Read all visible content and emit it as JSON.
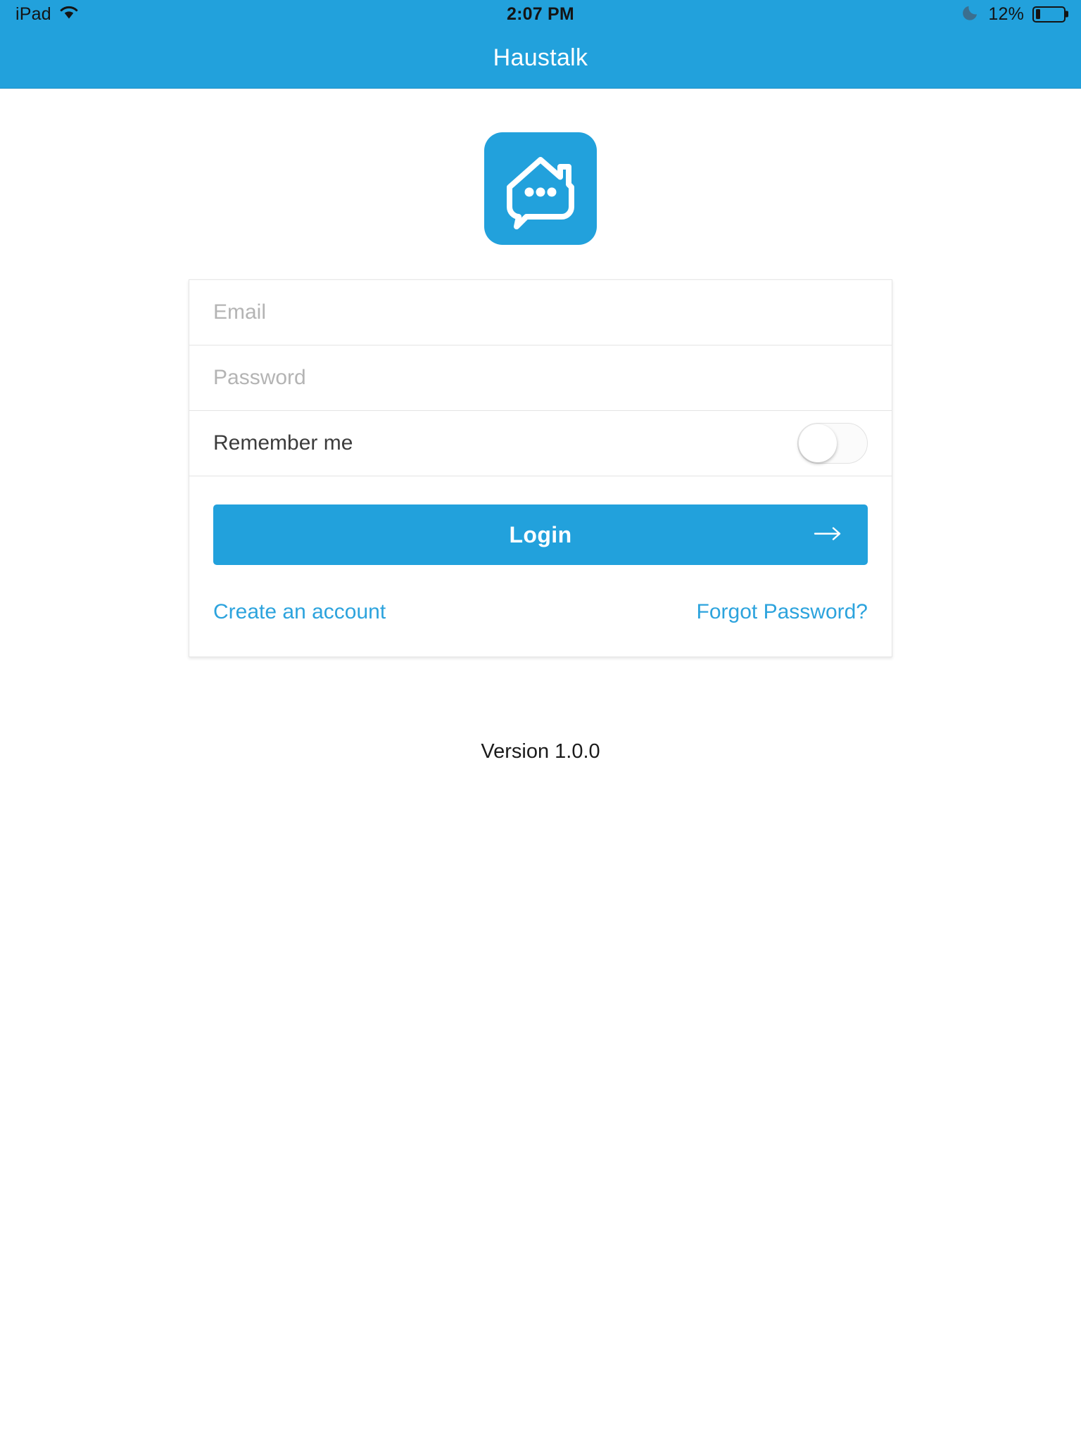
{
  "status_bar": {
    "device_label": "iPad",
    "wifi_icon": "wifi-icon",
    "time": "2:07 PM",
    "dnd_icon": "moon-icon",
    "battery_percent_label": "12%",
    "battery_percent_value": 12,
    "battery_icon": "battery-icon"
  },
  "nav_bar": {
    "title": "Haustalk"
  },
  "logo": {
    "icon_name": "haustalk-house-chat-logo",
    "tile_color": "#22a1dc",
    "mark_color": "#ffffff"
  },
  "form": {
    "email": {
      "placeholder": "Email",
      "value": ""
    },
    "password": {
      "placeholder": "Password",
      "value": ""
    },
    "remember_me": {
      "label": "Remember me",
      "checked": false
    }
  },
  "actions": {
    "login_label": "Login",
    "login_arrow_icon": "arrow-right-icon",
    "create_account_label": "Create an account",
    "forgot_password_label": "Forgot Password?"
  },
  "footer": {
    "version": "Version 1.0.0"
  },
  "colors": {
    "brand_blue": "#22a1dc",
    "link_blue": "#2ca3dd",
    "placeholder_gray": "#b4b4b4",
    "divider_gray": "#e4e4e4",
    "text_dark": "#3c3c3c"
  }
}
